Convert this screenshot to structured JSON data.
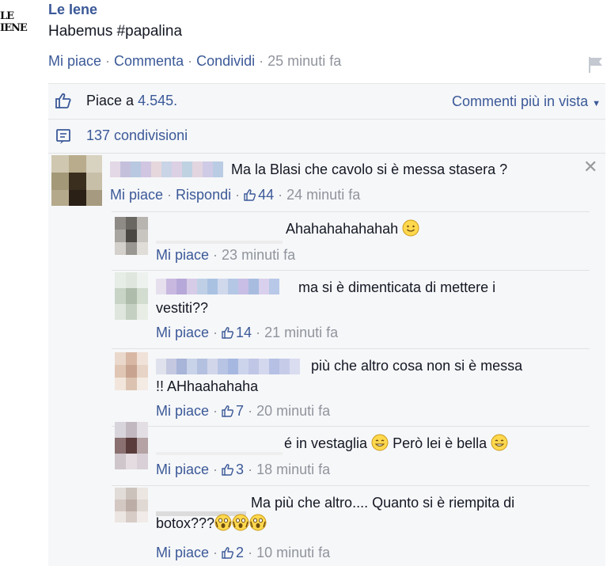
{
  "post": {
    "logo_text": "LE IENE",
    "page_name": "Le Iene",
    "text": "Habemus #papalina",
    "actions": {
      "like": "Mi piace",
      "comment": "Commenta",
      "share": "Condividi",
      "time": "25 minuti fa"
    }
  },
  "ufi": {
    "likes_prefix": "Piace a",
    "likes_count": "4.545.",
    "sort_label": "Commenti più in vista",
    "shares": "137 condivisioni"
  },
  "comments": [
    {
      "text": "Ma la Blasi che cavolo si è messa stasera ?",
      "like": "Mi piace",
      "reply": "Rispondi",
      "likes": "44",
      "time": "24 minuti fa"
    }
  ],
  "replies": [
    {
      "text": "Ahahahahahahah",
      "emoji": "smile",
      "like": "Mi piace",
      "likes": "",
      "time": "23 minuti fa"
    },
    {
      "text_line1": "ma si è dimenticata di mettere i",
      "text_line2": "vestiti??",
      "like": "Mi piace",
      "likes": "14",
      "time": "21 minuti fa"
    },
    {
      "text_line1": "più che altro cosa non si è messa",
      "text_line2": "!! AHhaahahaha",
      "like": "Mi piace",
      "likes": "7",
      "time": "20 minuti fa"
    },
    {
      "text_a": "é in vestaglia",
      "text_b": "Però lei è bella",
      "like": "Mi piace",
      "likes": "3",
      "time": "18 minuti fa"
    },
    {
      "text_line1": "Ma più che altro.... Quanto si è riempita di",
      "text_line2": "botox???",
      "like": "Mi piace",
      "likes": "2",
      "time": "10 minuti fa"
    }
  ],
  "colors": {
    "link": "#3b5998",
    "meta": "#90949c",
    "ufi_bg": "#f6f7f9"
  }
}
